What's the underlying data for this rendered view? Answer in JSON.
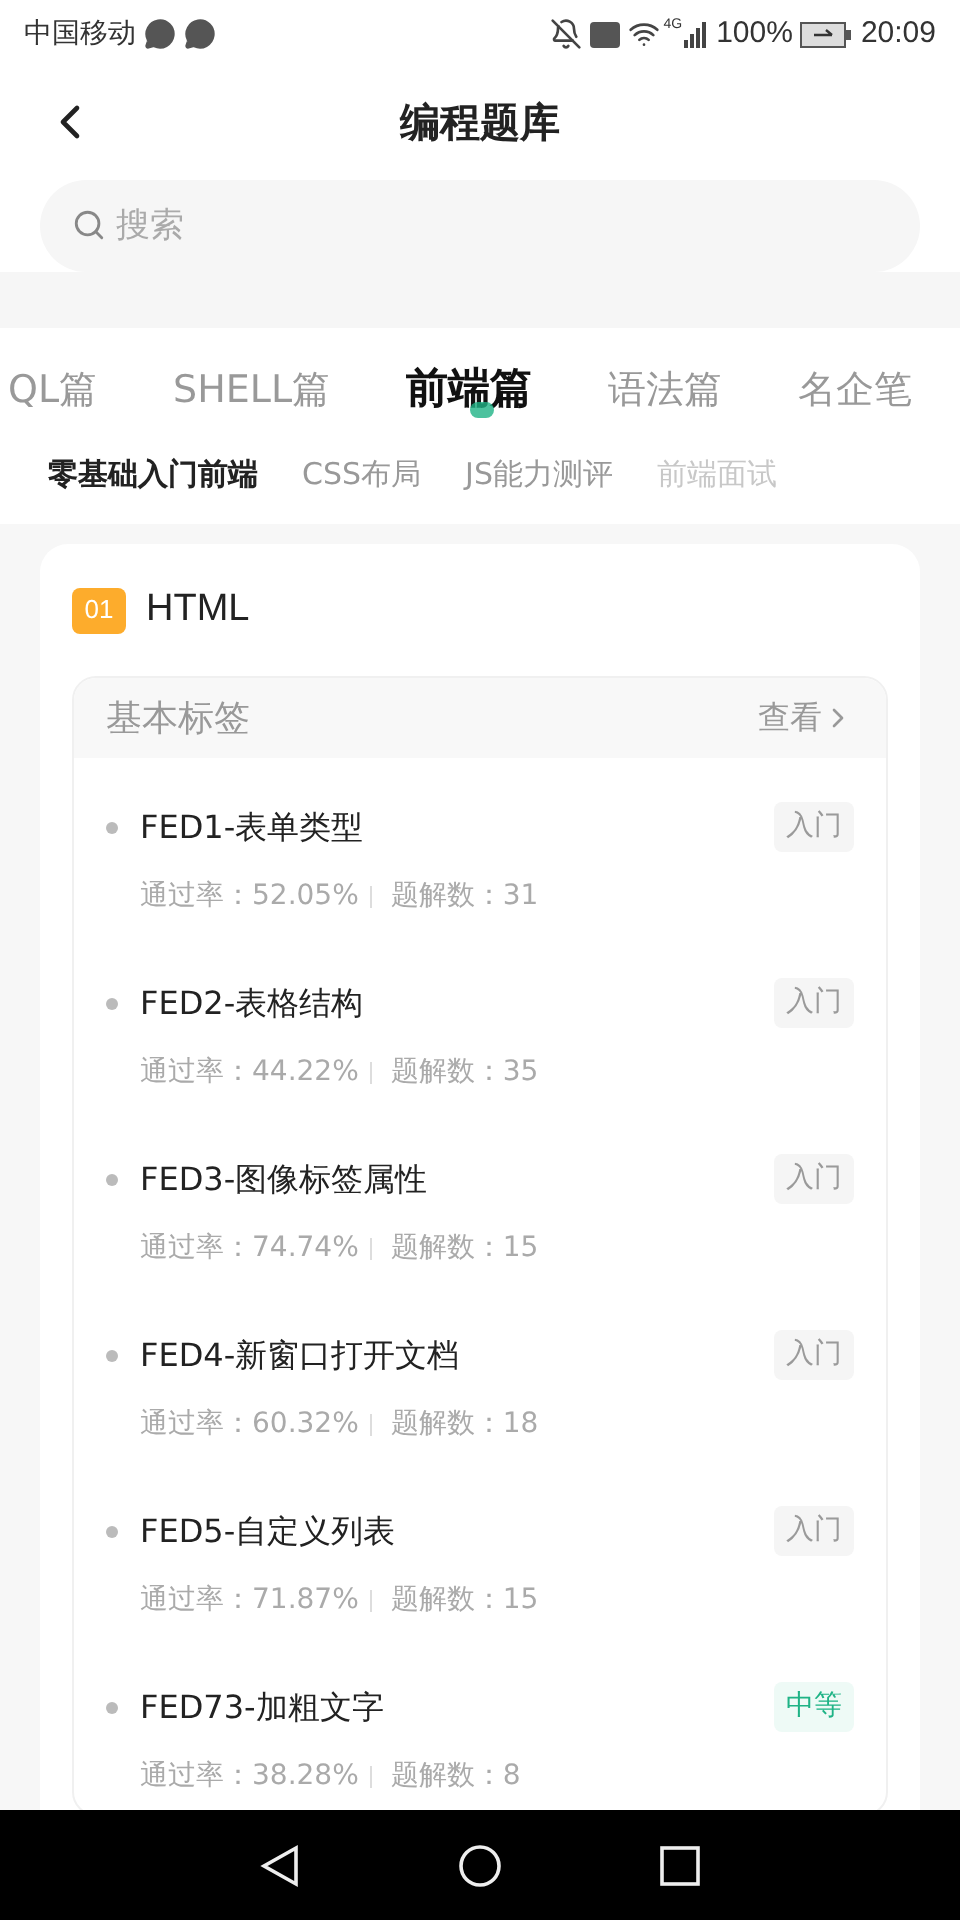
{
  "status_bar": {
    "carrier": "中国移动",
    "network": "4G",
    "battery": "100%",
    "time": "20:09"
  },
  "header": {
    "title": "编程题库"
  },
  "search": {
    "placeholder": "搜索"
  },
  "tabs": [
    {
      "label": "QL篇",
      "selected": false
    },
    {
      "label": "SHELL篇",
      "selected": false
    },
    {
      "label": "前端篇",
      "selected": true
    },
    {
      "label": "语法篇",
      "selected": false
    },
    {
      "label": "名企笔",
      "selected": false
    }
  ],
  "subtabs": [
    {
      "label": "零基础入门前端",
      "selected": true
    },
    {
      "label": "CSS布局",
      "selected": false
    },
    {
      "label": "JS能力测评",
      "selected": false
    },
    {
      "label": "前端面试",
      "selected": false
    }
  ],
  "section": {
    "number": "01",
    "title": "HTML",
    "group": {
      "title": "基本标签",
      "action": "查看",
      "problems": [
        {
          "title": "FED1-表单类型",
          "pass_rate_label": "通过率：",
          "pass_rate": "52.05%",
          "solutions_label": "题解数：",
          "solutions": "31",
          "difficulty": {
            "label": "入门",
            "kind": "easy"
          }
        },
        {
          "title": "FED2-表格结构",
          "pass_rate_label": "通过率：",
          "pass_rate": "44.22%",
          "solutions_label": "题解数：",
          "solutions": "35",
          "difficulty": {
            "label": "入门",
            "kind": "easy"
          }
        },
        {
          "title": "FED3-图像标签属性",
          "pass_rate_label": "通过率：",
          "pass_rate": "74.74%",
          "solutions_label": "题解数：",
          "solutions": "15",
          "difficulty": {
            "label": "入门",
            "kind": "easy"
          }
        },
        {
          "title": "FED4-新窗口打开文档",
          "pass_rate_label": "通过率：",
          "pass_rate": "60.32%",
          "solutions_label": "题解数：",
          "solutions": "18",
          "difficulty": {
            "label": "入门",
            "kind": "easy"
          }
        },
        {
          "title": "FED5-自定义列表",
          "pass_rate_label": "通过率：",
          "pass_rate": "71.87%",
          "solutions_label": "题解数：",
          "solutions": "15",
          "difficulty": {
            "label": "入门",
            "kind": "easy"
          }
        },
        {
          "title": "FED73-加粗文字",
          "pass_rate_label": "通过率：",
          "pass_rate": "38.28%",
          "solutions_label": "题解数：",
          "solutions": "8",
          "difficulty": {
            "label": "中等",
            "kind": "medium"
          }
        }
      ]
    }
  }
}
